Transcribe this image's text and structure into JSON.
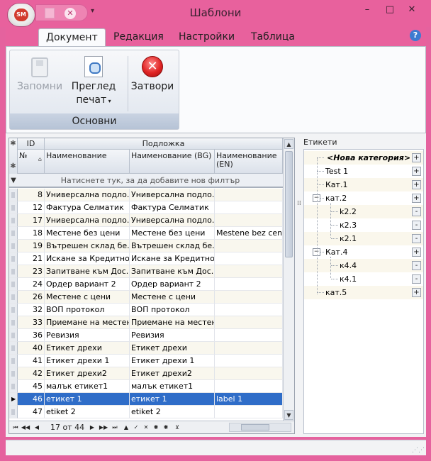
{
  "window": {
    "title": "Шаблони",
    "logo_text": "SM",
    "min_glyph": "–",
    "max_glyph": "□",
    "close_glyph": "✕"
  },
  "ribbon": {
    "tabs": [
      {
        "label": "Документ",
        "active": true
      },
      {
        "label": "Редакция",
        "active": false
      },
      {
        "label": "Настройки",
        "active": false
      },
      {
        "label": "Таблица",
        "active": false
      }
    ],
    "group_label": "Основни",
    "buttons": {
      "save": "Запомни",
      "preview_line1": "Преглед",
      "preview_line2": "печат",
      "close": "Затвори"
    }
  },
  "grid": {
    "band_id": "ID",
    "band_main": "Подложка",
    "col_no": "№",
    "col_name": "Наименование",
    "col_bg": "Наименование (BG)",
    "col_en": "Наименование (EN)",
    "filter_hint": "Натиснете тук, за да добавите нов филтър",
    "rows": [
      {
        "no": "8",
        "name": "Универсална подло...",
        "bg": "Универсална подло...",
        "en": ""
      },
      {
        "no": "12",
        "name": "Фактура Селматик",
        "bg": "Фактура Селматик",
        "en": ""
      },
      {
        "no": "17",
        "name": "Универсална подло...",
        "bg": "Универсална подло...",
        "en": ""
      },
      {
        "no": "18",
        "name": "Местене без цени",
        "bg": "Местене без цени",
        "en": "Mestene bez ceni"
      },
      {
        "no": "19",
        "name": "Вътрешен склад бе...",
        "bg": "Вътрешен склад бе...",
        "en": ""
      },
      {
        "no": "21",
        "name": "Искане за Кредитно...",
        "bg": "Искане за Кредитно...",
        "en": ""
      },
      {
        "no": "23",
        "name": "Запитване към Дос...",
        "bg": "Запитване към Дос...",
        "en": ""
      },
      {
        "no": "24",
        "name": "Ордер вариант 2",
        "bg": "Ордер вариант 2",
        "en": ""
      },
      {
        "no": "26",
        "name": "Местене с цени",
        "bg": "Местене с цени",
        "en": ""
      },
      {
        "no": "32",
        "name": "ВОП протокол",
        "bg": "ВОП протокол",
        "en": ""
      },
      {
        "no": "33",
        "name": "Приемане на местене",
        "bg": "Приемане на местене",
        "en": ""
      },
      {
        "no": "36",
        "name": "Ревизия",
        "bg": "Ревизия",
        "en": ""
      },
      {
        "no": "40",
        "name": "Етикет дрехи",
        "bg": "Етикет дрехи",
        "en": ""
      },
      {
        "no": "41",
        "name": "Етикет дрехи 1",
        "bg": "Етикет дрехи 1",
        "en": ""
      },
      {
        "no": "42",
        "name": "Етикет дрехи2",
        "bg": "Етикет дрехи2",
        "en": ""
      },
      {
        "no": "45",
        "name": "малък етикет1",
        "bg": "малък етикет1",
        "en": ""
      },
      {
        "no": "46",
        "name": "етикет 1",
        "bg": "етикет 1",
        "en": "label 1",
        "selected": true
      },
      {
        "no": "47",
        "name": "etiket 2",
        "bg": "etiket 2",
        "en": ""
      }
    ],
    "nav_text": "17 от 44"
  },
  "tree": {
    "title": "Етикети",
    "nodes": [
      {
        "label": "<Нова категория>",
        "level": 0,
        "btn": "+",
        "new": true
      },
      {
        "label": "Test 1",
        "level": 0,
        "btn": "+"
      },
      {
        "label": "Кат.1",
        "level": 0,
        "btn": "+"
      },
      {
        "label": "кат.2",
        "level": 0,
        "btn": "+",
        "expander": "−"
      },
      {
        "label": "k2.2",
        "level": 1,
        "btn": "-"
      },
      {
        "label": "к2.3",
        "level": 1,
        "btn": "-"
      },
      {
        "label": "к2.1",
        "level": 1,
        "btn": "-"
      },
      {
        "label": "Кат.4",
        "level": 0,
        "btn": "+",
        "expander": "−"
      },
      {
        "label": "к4.4",
        "level": 1,
        "btn": "-"
      },
      {
        "label": "к4.1",
        "level": 1,
        "btn": "-"
      },
      {
        "label": "кат.5",
        "level": 0,
        "btn": "+"
      }
    ]
  }
}
